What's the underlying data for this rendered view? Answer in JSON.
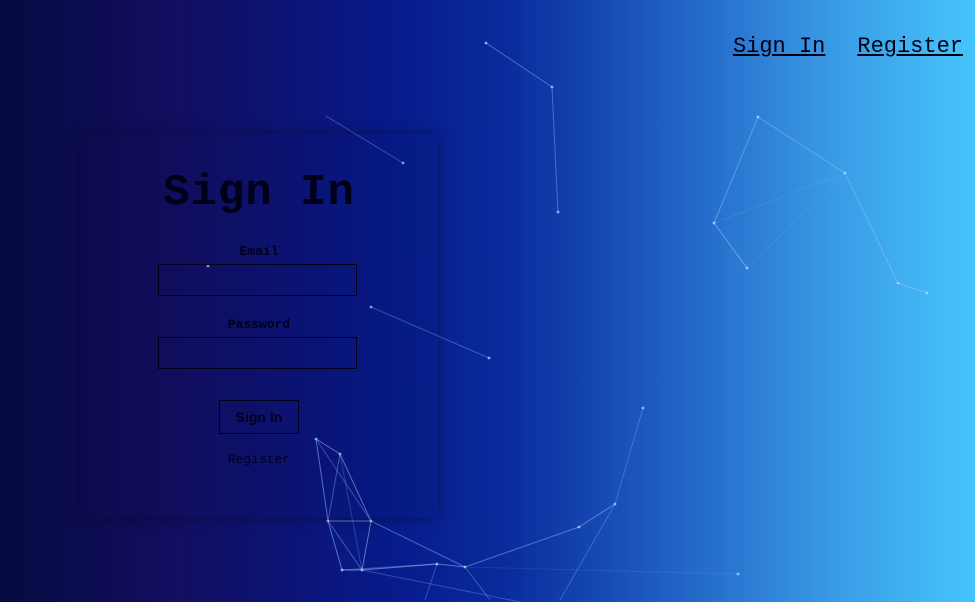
{
  "nav": {
    "sign_in": "Sign In",
    "register": "Register"
  },
  "form": {
    "title": "Sign In",
    "email_label": "Email",
    "email_value": "",
    "password_label": "Password",
    "password_value": "",
    "submit_label": "Sign In",
    "register_link": "Register"
  },
  "theme": {
    "gradient_start": "#060a40",
    "gradient_end": "#45c5fb",
    "text_color": "#000018"
  }
}
